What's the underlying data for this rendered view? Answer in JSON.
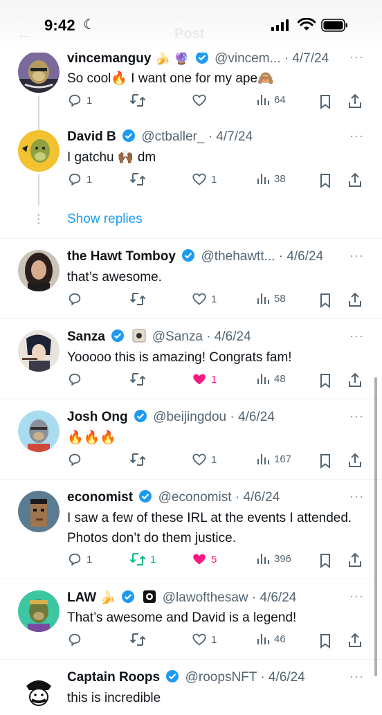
{
  "status": {
    "time": "9:42"
  },
  "nav": {
    "back_icon": "back-arrow-icon",
    "title": "Post"
  },
  "show_replies": "Show replies",
  "colors": {
    "accent": "#1d9bf0",
    "like": "#f91880",
    "retweet": "#00ba7c"
  },
  "tweets": [
    {
      "name": "vincemanguy",
      "name_emoji": "🍌 🔮",
      "handle": "@vincem...",
      "date": "· 4/7/24",
      "text": "So cool🔥 I want one for my ape🙈",
      "reply": "1",
      "retweet": "",
      "like": "",
      "views": "64"
    },
    {
      "name": "David B",
      "name_emoji": "",
      "handle": "@ctballer_",
      "date": "· 4/7/24",
      "text": "I gatchu 🙌🏾 dm",
      "reply": "1",
      "retweet": "",
      "like": "1",
      "views": "38"
    },
    {
      "name": "the Hawt Tomboy",
      "name_emoji": "",
      "handle": "@thehawtt...",
      "date": "· 4/6/24",
      "text": "that’s awesome.",
      "reply": "",
      "retweet": "",
      "like": "1",
      "views": "58"
    },
    {
      "name": "Sanza",
      "name_emoji": "",
      "handle": "@Sanza",
      "date": "· 4/6/24",
      "text": "Yooooo this is amazing! Congrats fam!",
      "reply": "",
      "retweet": "",
      "like": "1",
      "views": "48"
    },
    {
      "name": "Josh Ong",
      "name_emoji": "",
      "handle": "@beijingdou",
      "date": "· 4/6/24",
      "text": "🔥🔥🔥",
      "reply": "",
      "retweet": "",
      "like": "1",
      "views": "167"
    },
    {
      "name": "economist",
      "name_emoji": "",
      "handle": "@economist",
      "date": "· 4/6/24",
      "text": "I saw a few of these IRL at the events I attended. Photos don’t do them justice.",
      "reply": "1",
      "retweet": "1",
      "like": "5",
      "views": "396"
    },
    {
      "name": "LAW",
      "name_emoji": "🍌",
      "handle": "@lawofthesaw",
      "date": "· 4/6/24",
      "text": "That’s awesome and David is a legend!",
      "reply": "",
      "retweet": "",
      "like": "1",
      "views": "46"
    },
    {
      "name": "Captain Roops",
      "name_emoji": "",
      "handle": "@roopsNFT",
      "date": "· 4/6/24",
      "text": "this is incredible",
      "reply": "",
      "retweet": "",
      "like": "",
      "views": ""
    }
  ]
}
